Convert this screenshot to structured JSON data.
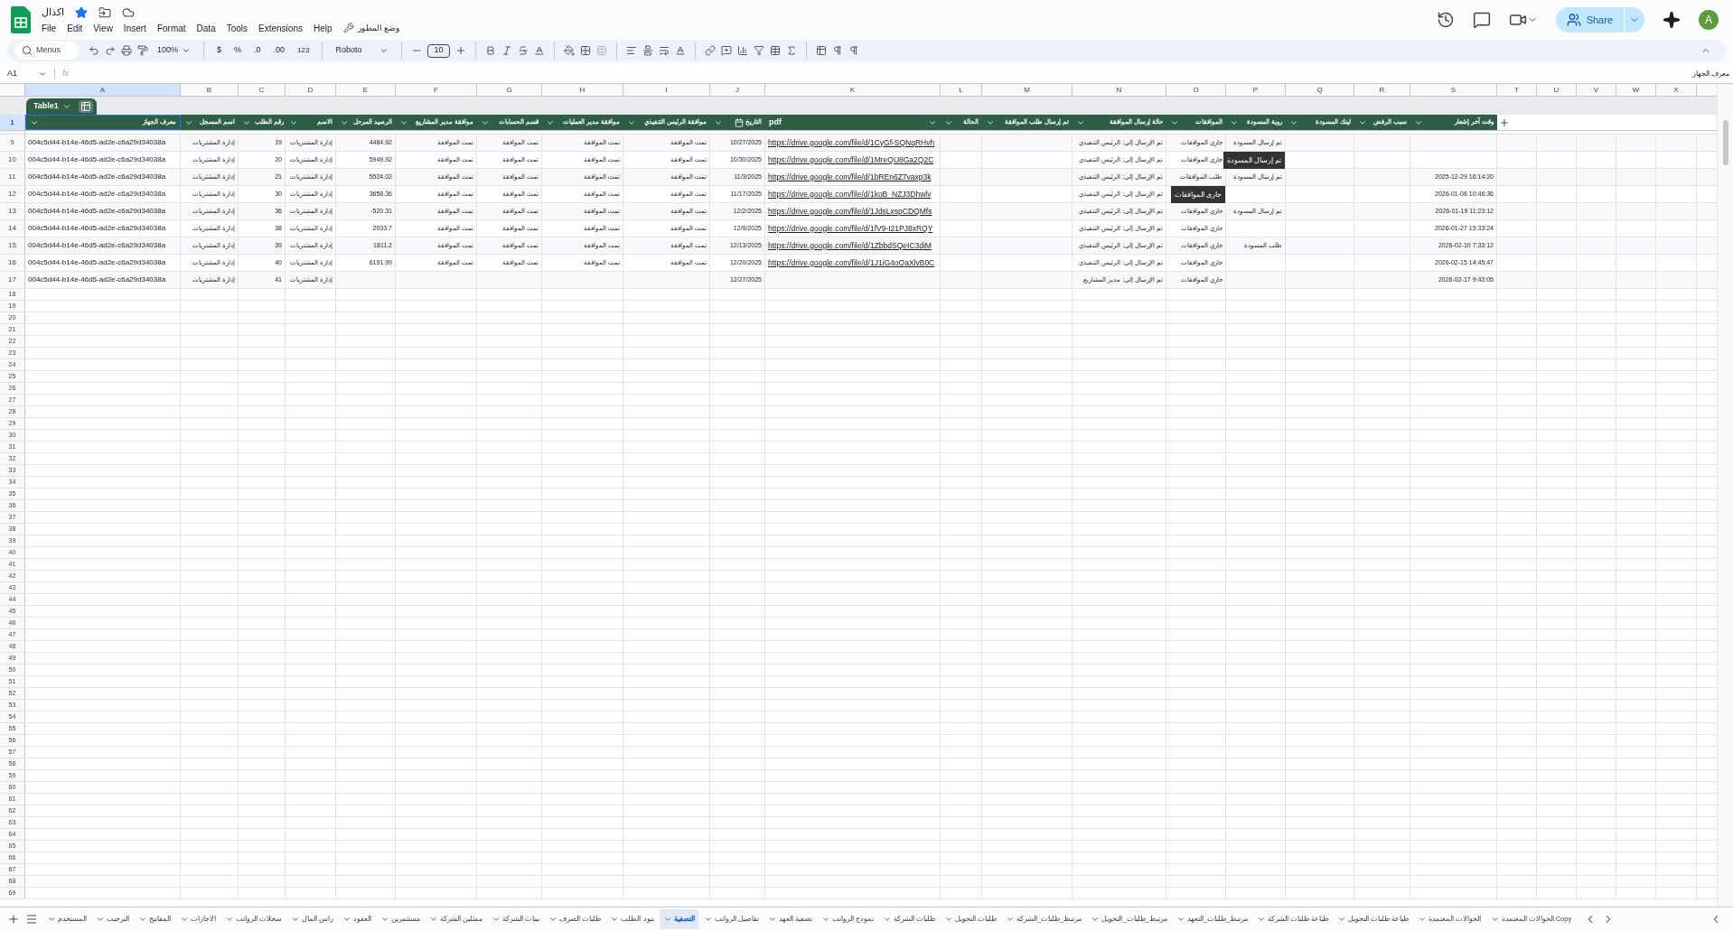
{
  "document": {
    "title": "اكذال",
    "starred": true
  },
  "menu": [
    "Help",
    "Extensions",
    "Tools",
    "Data",
    "Format",
    "Insert",
    "View",
    "Edit",
    "File"
  ],
  "developer_menu": "وضع المطور",
  "share": {
    "label": "Share"
  },
  "avatar": "A",
  "toolbar": {
    "search": "Menus",
    "zoom": "100%",
    "currency": "$",
    "percent": "%",
    "decrease_decimals": ".0",
    "increase_decimals": ".00",
    "number_format": "123",
    "font": "Roboto",
    "font_size": "10"
  },
  "formula_bar": {
    "cell": "A1",
    "fx": "fx",
    "value": "معرف الجهاز"
  },
  "columns": [
    {
      "label": "X",
      "selected": false
    },
    {
      "label": "W",
      "selected": false
    },
    {
      "label": "V",
      "selected": false
    },
    {
      "label": "U",
      "selected": false
    },
    {
      "label": "T",
      "selected": false
    },
    {
      "label": "S",
      "selected": false
    },
    {
      "label": "R",
      "selected": false
    },
    {
      "label": "Q",
      "selected": false
    },
    {
      "label": "P",
      "selected": false
    },
    {
      "label": "O",
      "selected": false
    },
    {
      "label": "N",
      "selected": false
    },
    {
      "label": "M",
      "selected": false
    },
    {
      "label": "L",
      "selected": false
    },
    {
      "label": "K",
      "selected": false
    },
    {
      "label": "J",
      "selected": false
    },
    {
      "label": "I",
      "selected": false
    },
    {
      "label": "H",
      "selected": false
    },
    {
      "label": "G",
      "selected": false
    },
    {
      "label": "F",
      "selected": false
    },
    {
      "label": "E",
      "selected": false
    },
    {
      "label": "D",
      "selected": false
    },
    {
      "label": "C",
      "selected": false
    },
    {
      "label": "B",
      "selected": false
    },
    {
      "label": "A",
      "selected": true
    }
  ],
  "table": {
    "name": "Table1",
    "header_row": {
      "number": "1",
      "selected": true
    },
    "headers": [
      {
        "label": "وقت آخر إشعار",
        "kind": "text"
      },
      {
        "label": "سبب الرفض",
        "kind": "text"
      },
      {
        "label": "لينك المسودة",
        "kind": "text"
      },
      {
        "label": "روية المسودة",
        "kind": "text"
      },
      {
        "label": "الموافقات",
        "kind": "text"
      },
      {
        "label": "حالة إرسال الموافقة",
        "kind": "text"
      },
      {
        "label": "تم إرسال طلب الموافقة",
        "kind": "text"
      },
      {
        "label": "الحالة",
        "kind": "text"
      },
      {
        "label": "pdf",
        "kind": "link"
      },
      {
        "label": "التاريخ",
        "kind": "date"
      },
      {
        "label": "موافقة الرئيس التنفيذي",
        "kind": "text"
      },
      {
        "label": "موافقة مدير العمليات",
        "kind": "text"
      },
      {
        "label": "قسم الحسابات",
        "kind": "text"
      },
      {
        "label": "موافقة مدير المشاريع",
        "kind": "text"
      },
      {
        "label": "الرصيد المرحل",
        "kind": "text"
      },
      {
        "label": "الاسم",
        "kind": "text"
      },
      {
        "label": "رقم الطلب",
        "kind": "text"
      },
      {
        "label": "اسم المسجل",
        "kind": "text"
      },
      {
        "label": "معرف الجهاز",
        "kind": "id"
      }
    ],
    "rows": [
      {
        "number": "9",
        "cells": [
          "",
          "",
          "",
          "تم إرسال المسودة",
          "جاري الموافقات",
          "تم الإرسال إلى: الرئيس التنفيذي",
          "",
          "",
          "https://drive.google.com/file/d/1CyGf-SQNqRHvh",
          "10/27/2025",
          "تمت الموافقة",
          "تمت الموافقة",
          "تمت الموافقة",
          "تمت الموافقة",
          "4484.92",
          "إدارة المشتريات",
          "19",
          "إدارة المشتريات",
          "004c5d44-b14e-46d5-ad2e-c6a29d34038a"
        ]
      },
      {
        "number": "10",
        "cells": [
          "",
          "",
          "",
          "",
          "جاري الموافقات",
          "تم الإرسال إلى: الرئيس التنفيذي",
          "",
          "",
          "https://drive.google.com/file/d/1MreQU8Ga2Q2C",
          "10/30/2025",
          "تمت الموافقة",
          "تمت الموافقة",
          "تمت الموافقة",
          "تمت الموافقة",
          "5949.92",
          "إدارة المشتريات",
          "20",
          "إدارة المشتريات",
          "004c5d44-b14e-46d5-ad2e-c6a29d34038a"
        ],
        "callout": {
          "kind": "draft",
          "text": "تم إرسال المسودة"
        }
      },
      {
        "number": "11",
        "cells": [
          "2025-12-29 16:14:20",
          "",
          "",
          "تم إرسال المسودة",
          "طلب الموافقات",
          "تم الإرسال إلى: الرئيس التنفيذي",
          "",
          "",
          "https://drive.google.com/file/d/1bREn6Z7vaxp3k",
          "11/3/2025",
          "تمت الموافقة",
          "تمت الموافقة",
          "تمت الموافقة",
          "تمت الموافقة",
          "5524.02",
          "إدارة المشتريات",
          "21",
          "إدارة المشتريات",
          "004c5d44-b14e-46d5-ad2e-c6a29d34038a"
        ]
      },
      {
        "number": "12",
        "cells": [
          "2026-01-08 10:46:36",
          "",
          "",
          "",
          "",
          "تم الإرسال إلى: الرئيس التنفيذي",
          "",
          "",
          "https://drive.google.com/file/d/1koB_NZJ3Dhwlv",
          "11/17/2025",
          "تمت الموافقة",
          "تمت الموافقة",
          "تمت الموافقة",
          "تمت الموافقة",
          "3658.36",
          "إدارة المشتريات",
          "30",
          "إدارة المشتريات",
          "004c5d44-b14e-46d5-ad2e-c6a29d34038a"
        ],
        "callout": {
          "kind": "approvals",
          "text": "جارى الموافقات"
        }
      },
      {
        "number": "13",
        "cells": [
          "2026-01-19 11:23:12",
          "",
          "",
          "تم إرسال المسودة",
          "جاري الموافقات",
          "تم الإرسال إلى: الرئيس التنفيذي",
          "",
          "",
          "https://drive.google.com/file/d/1JdsLxspCDQMfs",
          "12/2/2025",
          "تمت الموافقة",
          "تمت الموافقة",
          "تمت الموافقة",
          "تمت الموافقة",
          "-520.31",
          "إدارة المشتريات",
          "36",
          "إدارة المشتريات",
          "004c5d44-b14e-46d5-ad2e-c6a29d34038a"
        ]
      },
      {
        "number": "14",
        "cells": [
          "2026-01-27 15:33:24",
          "",
          "",
          "",
          "جاري الموافقات",
          "تم الإرسال إلى: الرئيس التنفيذي",
          "",
          "",
          "https://drive.google.com/file/d/1fV9-I21PJ8xRQY",
          "12/9/2025",
          "تمت الموافقة",
          "تمت الموافقة",
          "تمت الموافقة",
          "تمت الموافقة",
          "2033.7",
          "إدارة المشتريات",
          "38",
          "إدارة المشتريات",
          "004c5d44-b14e-46d5-ad2e-c6a29d34038a"
        ]
      },
      {
        "number": "15",
        "cells": [
          "2026-02-10 7:33:12",
          "",
          "",
          "طلب المسودة",
          "جاري الموافقات",
          "تم الإرسال إلى: الرئيس التنفيذي",
          "",
          "",
          "https://drive.google.com/file/d/1ZbbdSQeIC3diM",
          "12/13/2025",
          "تمت الموافقة",
          "تمت الموافقة",
          "تمت الموافقة",
          "تمت الموافقة",
          "1811.2",
          "إدارة المشتريات",
          "39",
          "إدارة المشتريات",
          "004c5d44-b14e-46d5-ad2e-c6a29d34038a"
        ]
      },
      {
        "number": "16",
        "cells": [
          "2026-02-15 14:45:47",
          "",
          "",
          "",
          "جاري الموافقات",
          "تم الإرسال إلى: الرئيس التنفيذي",
          "",
          "",
          "https://drive.google.com/file/d/1J1iG4oOaXlvB0C",
          "12/20/2025",
          "تمت الموافقة",
          "تمت الموافقة",
          "تمت الموافقة",
          "تمت الموافقة",
          "6191.99",
          "إدارة المشتريات",
          "40",
          "إدارة المشتريات",
          "004c5d44-b14e-46d5-ad2e-c6a29d34038a"
        ]
      },
      {
        "number": "17",
        "cells": [
          "2026-02-17 9:43:05",
          "",
          "",
          "",
          "جاري الموافقات",
          "تم الإرسال إلى: مدير المشاريع",
          "",
          "",
          "",
          "12/27/2025",
          "",
          "",
          "",
          "",
          "",
          "إدارة المشتريات",
          "41",
          "إدارة المشتريات",
          "004c5d44-b14e-46d5-ad2e-c6a29d34038a"
        ]
      }
    ]
  },
  "empty_rows": [
    "18",
    "19",
    "20",
    "21",
    "22",
    "23",
    "24",
    "25",
    "26",
    "27",
    "28",
    "29",
    "30",
    "31",
    "32",
    "33",
    "34",
    "35",
    "36",
    "37",
    "38",
    "39",
    "40",
    "41",
    "42",
    "43",
    "44",
    "45",
    "46",
    "47",
    "48",
    "49",
    "50",
    "51",
    "52",
    "53",
    "54",
    "55",
    "56",
    "57",
    "58",
    "59",
    "60",
    "61",
    "62",
    "63",
    "64",
    "65",
    "66",
    "67",
    "68",
    "69"
  ],
  "sheet_tabs": [
    {
      "label": "الحوالات المعتمدة Copy",
      "selected": false
    },
    {
      "label": "الحوالات المعتمدة",
      "selected": false
    },
    {
      "label": "طباعة طلبات التحويل",
      "selected": false
    },
    {
      "label": "طباعة طلبات الشركة",
      "selected": false
    },
    {
      "label": "مرتبط_طلبات_التعهد",
      "selected": false
    },
    {
      "label": "مرتبط_طلبات_التحويل",
      "selected": false
    },
    {
      "label": "مرتبط_طلبات_الشركة",
      "selected": false
    },
    {
      "label": "طلبات التحويل",
      "selected": false
    },
    {
      "label": "طلبات الشركة",
      "selected": false
    },
    {
      "label": "نموذج الرواتب",
      "selected": false
    },
    {
      "label": "تصفية العهد",
      "selected": false
    },
    {
      "label": "تفاصيل الرواتب",
      "selected": false
    },
    {
      "label": "التصفية",
      "selected": true
    },
    {
      "label": "بنود الطلب",
      "selected": false
    },
    {
      "label": "طلبات الصرف",
      "selected": false
    },
    {
      "label": "بينات الشركة",
      "selected": false
    },
    {
      "label": "ممثلين الشركة",
      "selected": false
    },
    {
      "label": "مستثمرين",
      "selected": false
    },
    {
      "label": "العقود",
      "selected": false
    },
    {
      "label": "راس المال",
      "selected": false
    },
    {
      "label": "سجلات الرواتب",
      "selected": false
    },
    {
      "label": "الاجازات",
      "selected": false
    },
    {
      "label": "المفاتيح",
      "selected": false
    },
    {
      "label": "الترحيب",
      "selected": false
    },
    {
      "label": "المستخدم",
      "selected": false
    }
  ]
}
